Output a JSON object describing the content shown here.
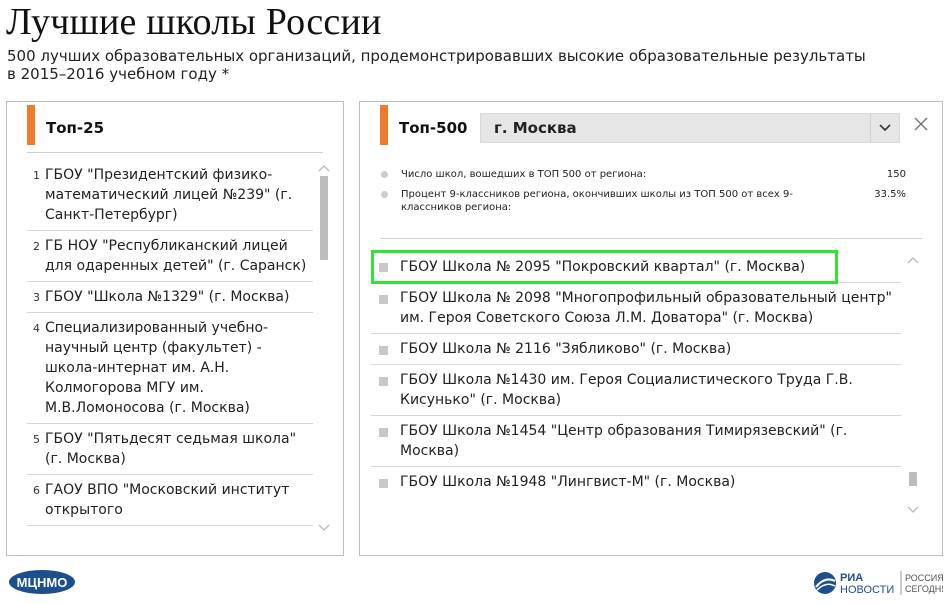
{
  "header": {
    "title": "Лучшие школы России",
    "subtitle": "500 лучших образовательных организаций, продемонстрировавших высокие образовательные результаты в 2015–2016 учебном году *"
  },
  "top25": {
    "title": "Топ-25",
    "items": [
      {
        "num": "1",
        "text": "ГБОУ \"Президентский физико-математический лицей №239\" (г. Санкт-Петербург)"
      },
      {
        "num": "2",
        "text": "ГБ НОУ \"Республиканский лицей для одаренных детей\" (г. Саранск)"
      },
      {
        "num": "3",
        "text": "ГБОУ \"Школа №1329\" (г. Москва)"
      },
      {
        "num": "4",
        "text": "Специализированный учебно-научный центр (факультет) - школа-интернат им. А.Н. Колмогорова МГУ им. М.В.Ломоносова (г. Москва)"
      },
      {
        "num": "5",
        "text": "ГБОУ \"Пятьдесят седьмая школа\" (г. Москва)"
      },
      {
        "num": "6",
        "text": "ГАОУ ВПО \"Московский институт открытого"
      }
    ]
  },
  "top500": {
    "title": "Топ-500",
    "region_select": {
      "value": "г. Москва"
    },
    "stats": [
      {
        "label": "Число школ, вошедших в ТОП 500 от региона:",
        "value": "150"
      },
      {
        "label": "Процент 9-классников региона, окончивших школы из ТОП 500 от всех 9-классников региона:",
        "value": "33.5%"
      }
    ],
    "schools": [
      "ГБОУ Школа № 2095 \"Покровский квартал\" (г. Москва)",
      "ГБОУ Школа № 2098 \"Многопрофильный образовательный центр\" им. Героя Советского Союза Л.М. Доватора\" (г. Москва)",
      "ГБОУ Школа № 2116 \"Зябликово\" (г. Москва)",
      "ГБОУ Школа №1430 им. Героя Социалистического Труда Г.В. Кисунько\" (г. Москва)",
      "ГБОУ Школа №1454 \"Центр образования Тимирязевский\" (г. Москва)",
      "ГБОУ Школа №1948 \"Лингвист-М\" (г. Москва)"
    ]
  },
  "footer": {
    "left_logo": "МЦНМО",
    "right_logo_line1": "РИА",
    "right_logo_line2": "НОВОСТИ",
    "right_logo_line3": "РОССИЯ",
    "right_logo_line4": "СЕГОДНЯ"
  },
  "colors": {
    "accent": "#f07b2a",
    "highlight": "#2ee62e",
    "logo_blue": "#1d4f8c"
  }
}
